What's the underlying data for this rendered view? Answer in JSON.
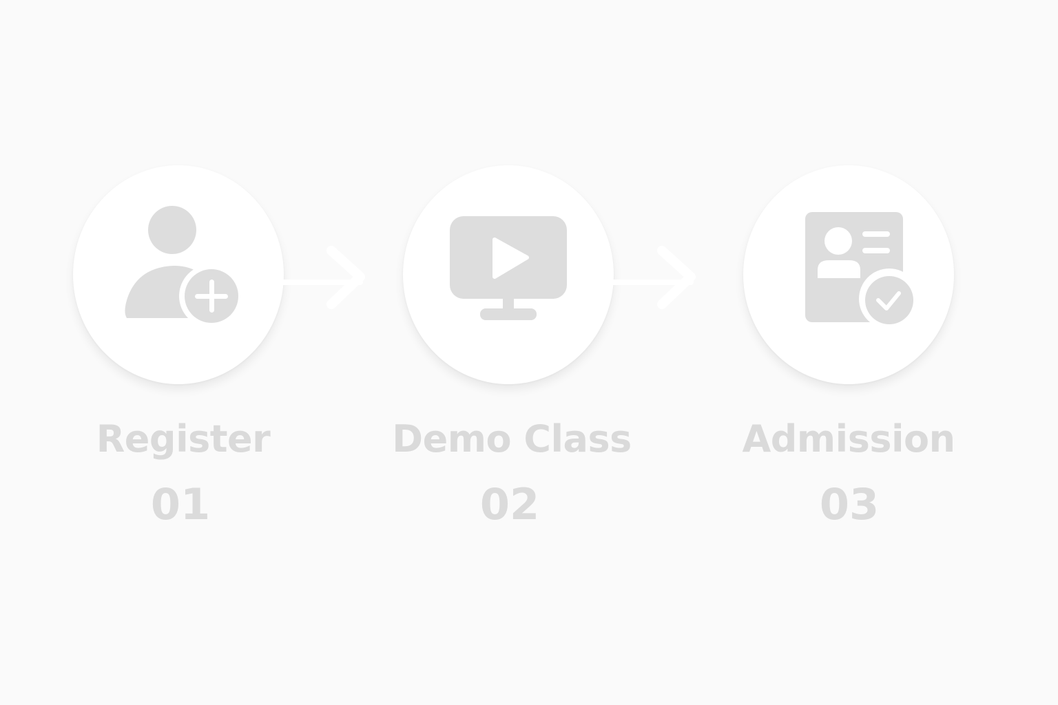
{
  "steps": [
    {
      "label": "Register",
      "number": "01",
      "icon": "user-plus-icon"
    },
    {
      "label": "Demo Class",
      "number": "02",
      "icon": "monitor-play-icon"
    },
    {
      "label": "Admission",
      "number": "03",
      "icon": "id-card-check-icon"
    }
  ],
  "colors": {
    "background": "#fafafa",
    "circle": "#ffffff",
    "icon": "#dddddd",
    "text": "#dadada"
  }
}
